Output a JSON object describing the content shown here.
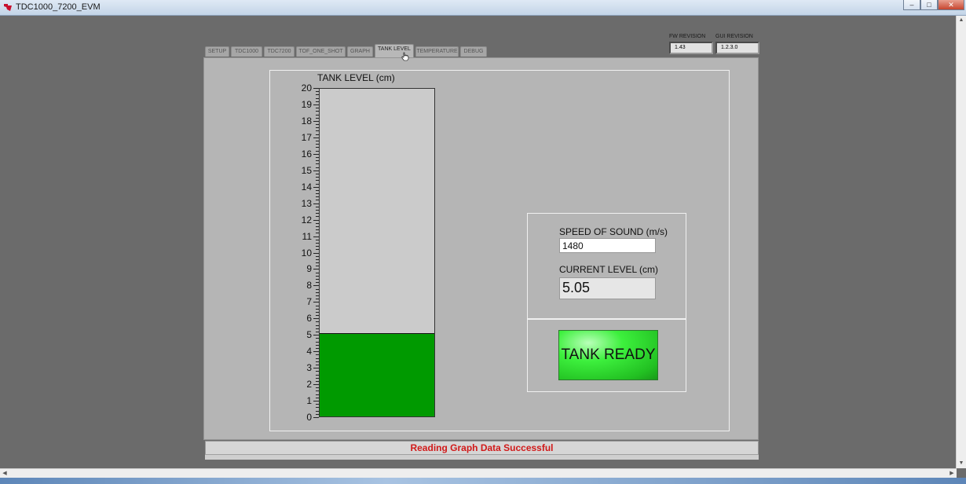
{
  "window": {
    "title": "TDC1000_7200_EVM",
    "minimize": "–",
    "maximize": "□",
    "close": "✕"
  },
  "revisions": {
    "fw_label": "FW REVISION",
    "fw_value": "1.43",
    "gui_label": "GUI REVISION",
    "gui_value": "1.2.3.0"
  },
  "tabs": [
    {
      "label": "SETUP"
    },
    {
      "label": "TDC1000"
    },
    {
      "label": "TDC7200"
    },
    {
      "label": "TOF_ONE_SHOT"
    },
    {
      "label": "GRAPH"
    },
    {
      "label": "TANK LEVEL"
    },
    {
      "label": "TEMPERATURE"
    },
    {
      "label": "DEBUG"
    }
  ],
  "active_tab": "TANK LEVEL",
  "tank_gauge": {
    "title": "TANK LEVEL (cm)",
    "min": 0,
    "max": 20,
    "value": 5.05,
    "fill_color": "#009a00",
    "ticks": [
      "0",
      "1",
      "2",
      "3",
      "4",
      "5",
      "6",
      "7",
      "8",
      "9",
      "10",
      "11",
      "12",
      "13",
      "14",
      "15",
      "16",
      "17",
      "18",
      "19",
      "20"
    ]
  },
  "speed_of_sound": {
    "label": "SPEED OF SOUND (m/s)",
    "value": "1480"
  },
  "current_level": {
    "label": "CURRENT LEVEL (cm)",
    "value": "5.05"
  },
  "tank_ready_button": {
    "label": "TANK READY",
    "color": "#33e033"
  },
  "status": {
    "message": "Reading Graph Data Successful",
    "color": "#d11a1a"
  }
}
